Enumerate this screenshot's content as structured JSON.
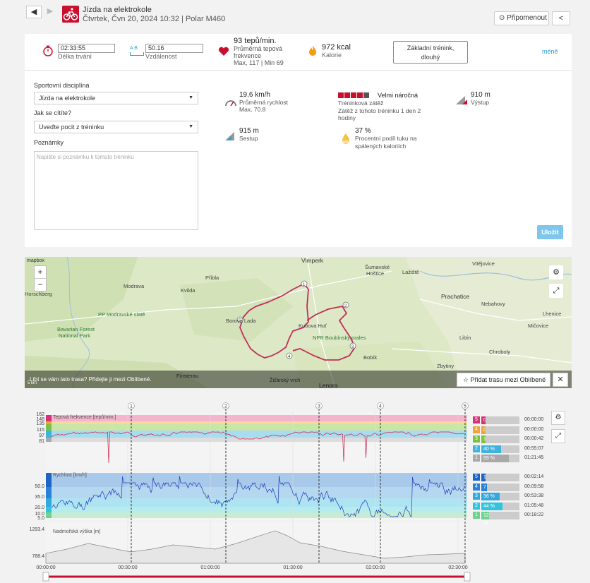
{
  "header": {
    "back_label": "◀",
    "forward_label": "▶",
    "title": "Jízda na elektrokole",
    "subtitle": "Čtvrtek, Čvn 20, 2024 10:32 | Polar M460",
    "remind_label": "Připomenout",
    "share_label": "share"
  },
  "summary": {
    "duration_value": "02:33:55",
    "duration_label": "Délka trvání",
    "distance_value": "50.16",
    "distance_label": "Vzdálenost",
    "distance_units_ab": "A  B",
    "hr_value": "93 tepů/min.",
    "hr_label_1": "Průměrná tepová",
    "hr_label_2": "frekvence",
    "hr_minmax": "Max, 117  |  Min 69",
    "kcal_value": "972 kcal",
    "kcal_label": "Kalorie",
    "type_line1": "Základní trénink,",
    "type_line2": "dlouhý",
    "less_label": "méně"
  },
  "form": {
    "sport_label": "Sportovní disciplína",
    "sport_value": "Jízda na elektrokole",
    "feel_label": "Jak se cítíte?",
    "feel_value": "Uveďte pocit z tréninku",
    "notes_label": "Poznámky",
    "notes_placeholder": "Napište si poznámku k tomuto tréninku",
    "save_label": "Uložit"
  },
  "metrics": {
    "speed_value": "19,6 km/h",
    "speed_label": "Průměrná rychlost",
    "speed_max": "Max, 70.8",
    "load_value": "Velmi náročná",
    "load_label": "Tréninková zátěž",
    "load_desc_1": "Zátěž z tohoto tréninku 1 den 2",
    "load_desc_2": "hodiny",
    "ascent_value": "910 m",
    "ascent_label": "Výstup",
    "descent_value": "915 m",
    "descent_label": "Sestup",
    "fat_value": "37 %",
    "fat_label_1": "Procentní podíl tuku na",
    "fat_label_2": "spálených kaloriích"
  },
  "map": {
    "footer_text": "Líbí se vám tato trasa?   Přidejte ji mezi Oblíbené.",
    "add_fav_label": "Přidat trasu mezi Oblíbené",
    "close_label": "✕",
    "zoom_in": "+",
    "zoom_out": "−",
    "scale_label": "5 km",
    "logo": "mapbox",
    "places": {
      "vimperk": "Vimperk",
      "sumavske": "Šumavské",
      "hostice": "Hoštice",
      "lazistě": "Lažiště",
      "vitejovice": "Vitějovice",
      "modrava": "Modrava",
      "kvilda": "Kvilda",
      "pribla": "Přibla",
      "horschberg": "Horschberg",
      "pp_modravske": "PP Modravské slatě",
      "bavarian_1": "Bavarian Forest",
      "bavarian_2": "National Park",
      "prachatice": "Prachatice",
      "nebahovy": "Nebahovy",
      "lhenice": "Lhenice",
      "micovice": "Mičovice",
      "libin": "Libín",
      "chroboly": "Chroboly",
      "zbytiny": "Zbytiny",
      "kubova_hut": "Kubova Huť",
      "npr_boubin": "NPR Boubínský prales",
      "borova_lada": "Borová Lada",
      "bobik": "Bobík",
      "finsterau": "Finsterau",
      "zdobsky": "Žďárský vrch",
      "lenora": "Lenora"
    },
    "markers": [
      "1",
      "2",
      "3",
      "4",
      "5"
    ]
  },
  "graph": {
    "hr_title": "Tepová frekvence [tepů/min.]",
    "speed_title": "Rychlost [km/h]",
    "alt_title": "Nadmořská výška [m]",
    "hr_ticks": [
      "162",
      "148",
      "135",
      "115",
      "97",
      "81"
    ],
    "speed_ticks": [
      "50.0",
      "35.0",
      "20.0",
      "10.0",
      "5.0"
    ],
    "alt_ticks": [
      "1293.4",
      "788.4"
    ],
    "time_ticks": [
      "00:00:00",
      "00:30:00",
      "01:00:00",
      "01:30:00",
      "02:00:00",
      "02:30:00"
    ],
    "lap_labels": [
      "1",
      "2",
      "3",
      "4",
      "5"
    ],
    "hr_zones": [
      {
        "zone": "5",
        "pct": "0 %",
        "time": "00:00:00",
        "color": "#d6327a"
      },
      {
        "zone": "4",
        "pct": "0 %",
        "time": "00:00:00",
        "color": "#f0a33b"
      },
      {
        "zone": "3",
        "pct": "1 %",
        "time": "00:00:42",
        "color": "#7cc242"
      },
      {
        "zone": "2",
        "pct": "40 %",
        "time": "00:55:07",
        "color": "#3fb3e0"
      },
      {
        "zone": "1",
        "pct": "59 %",
        "time": "01:21:45",
        "color": "#a9a9a9"
      }
    ],
    "speed_zones": [
      {
        "zone": "5",
        "pct": "1 %",
        "time": "00:02:14",
        "color": "#1d64c4"
      },
      {
        "zone": "4",
        "pct": "7 %",
        "time": "00:09:58",
        "color": "#2a82d6"
      },
      {
        "zone": "3",
        "pct": "36 %",
        "time": "00:53:38",
        "color": "#33a8dd"
      },
      {
        "zone": "2",
        "pct": "44 %",
        "time": "01:05:48",
        "color": "#33c3df"
      },
      {
        "zone": "1",
        "pct": "12 %",
        "time": "00:18:22",
        "color": "#6fd28d"
      }
    ]
  },
  "colors": {
    "brand": "#c8102e",
    "accent": "#2a9fd6",
    "route": "#c0305a"
  }
}
